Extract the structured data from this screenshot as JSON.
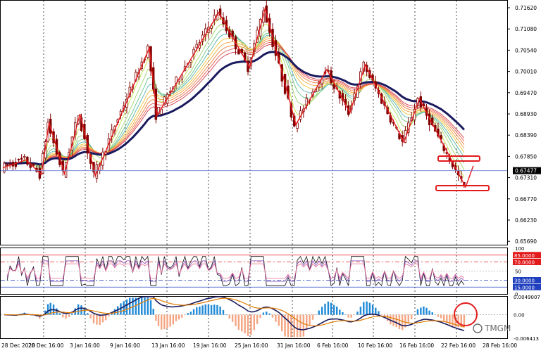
{
  "colors": {
    "background": "#ffffff",
    "grid": "#c0c0c0",
    "bull_candle": "#800000",
    "bear_candle": "#800000",
    "zigzag": "#e31a1c",
    "slow_ma": "#1a1a5e",
    "current_price_line": "#6b7fd7",
    "price_tag_bg": "#000000",
    "level85_tag": "#e31a1c",
    "level70_tag": "#e31a1c",
    "level30_tag": "#1f3fbf",
    "level15_tag": "#1f3fbf",
    "macd_pos": "#1f8ad8",
    "macd_neg": "#f4a582",
    "macd_signal": "#e07b00",
    "macd_main": "#1a1a5e",
    "highlight": "#e31a1c"
  },
  "price_panel": {
    "current_price": "0.67477",
    "y_ticks": [
      "0.71620",
      "0.71080",
      "0.70540",
      "0.70010",
      "0.69470",
      "0.68930",
      "0.68390",
      "0.67850",
      "0.67310",
      "0.66770",
      "0.66230",
      "0.65690"
    ]
  },
  "rsi_panel": {
    "y_ticks": [
      "100",
      "85.0000",
      "70.0000",
      "50",
      "30.0000",
      "15.0000",
      "0"
    ],
    "tags": [
      "85.0000",
      "70.0000",
      "30.0000",
      "15.0000"
    ]
  },
  "macd_panel": {
    "y_ticks": [
      "0.0049007",
      "0.00",
      "-0.006413"
    ]
  },
  "x_axis": {
    "labels": [
      "28 Dec 2020",
      "28 Dec 16:00",
      "3 Jan 16:00",
      "9 Jan 16:00",
      "13 Jan 16:00",
      "19 Jan 16:00",
      "25 Jan 16:00",
      "31 Jan 16:00",
      "6 Feb 16:00",
      "10 Feb 16:00",
      "16 Feb 16:00",
      "22 Feb 16:00",
      "28 Feb 16:00"
    ]
  },
  "watermark": "TMGM",
  "chart_data": {
    "type": "line",
    "symbol": "",
    "price_axis_range": [
      0.6569,
      0.7162
    ],
    "last_price": 0.67477,
    "zigzag_turns": [
      {
        "x": "28 Dec",
        "y": 0.6755
      },
      {
        "x": "31 Dec",
        "y": 0.6775
      },
      {
        "x": "2 Jan",
        "y": 0.6738
      },
      {
        "x": "3 Jan",
        "y": 0.687
      },
      {
        "x": "5 Jan",
        "y": 0.674
      },
      {
        "x": "7 Jan",
        "y": 0.6892
      },
      {
        "x": "9 Jan",
        "y": 0.6735
      },
      {
        "x": "16 Jan",
        "y": 0.706
      },
      {
        "x": "17 Jan",
        "y": 0.6888
      },
      {
        "x": "25 Jan",
        "y": 0.715
      },
      {
        "x": "29 Jan",
        "y": 0.701
      },
      {
        "x": "31 Jan",
        "y": 0.716
      },
      {
        "x": "4 Feb",
        "y": 0.6865
      },
      {
        "x": "8 Feb",
        "y": 0.7005
      },
      {
        "x": "11 Feb",
        "y": 0.6895
      },
      {
        "x": "13 Feb",
        "y": 0.7017
      },
      {
        "x": "18 Feb",
        "y": 0.682
      },
      {
        "x": "20 Feb",
        "y": 0.693
      },
      {
        "x": "26 Feb",
        "y": 0.6706
      },
      {
        "x": "27 Feb",
        "y": 0.676
      }
    ],
    "rsi_levels": [
      85,
      70,
      50,
      30,
      15
    ],
    "macd_range": [
      -0.006413,
      0.0049007
    ]
  }
}
